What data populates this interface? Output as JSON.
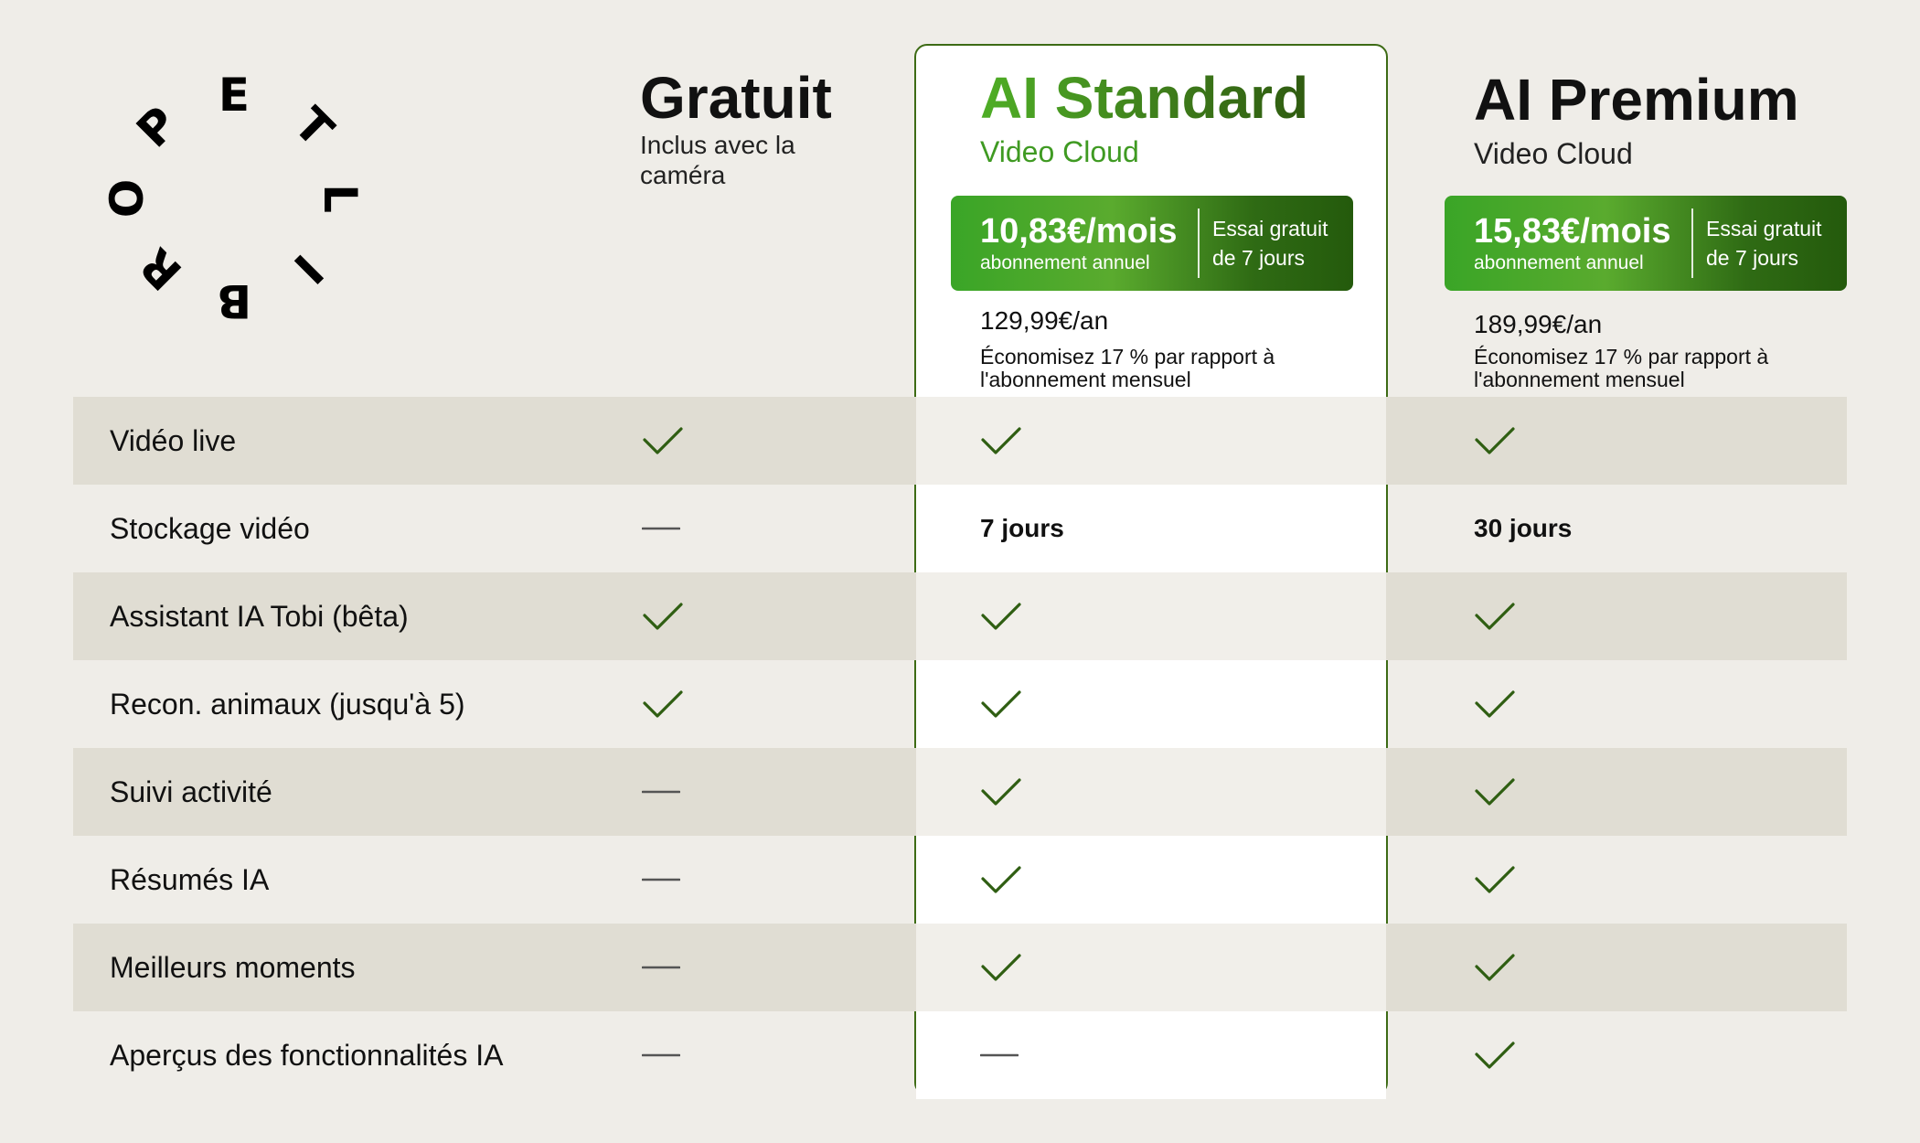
{
  "brand": {
    "letters": [
      "E",
      "T",
      "L",
      "I",
      "B",
      "R",
      "O",
      "P"
    ]
  },
  "plans": [
    {
      "id": "free",
      "title": "Gratuit",
      "subtitle": "Inclus avec la caméra"
    },
    {
      "id": "standard",
      "title": "AI Standard",
      "subtitle": "Video Cloud",
      "price_monthly": "10,83€/mois",
      "price_note": "abonnement annuel",
      "trial": "Essai gratuit de 7 jours",
      "price_annual": "129,99€/an",
      "savings": "Économisez 17 % par rapport à l'abonnement mensuel"
    },
    {
      "id": "premium",
      "title": "AI Premium",
      "subtitle": "Video Cloud",
      "price_monthly": "15,83€/mois",
      "price_note": "abonnement annuel",
      "trial": "Essai gratuit de 7 jours",
      "price_annual": "189,99€/an",
      "savings": "Économisez 17 % par rapport à l'abonnement mensuel"
    }
  ],
  "features": [
    {
      "label": "Vidéo live",
      "free": "check",
      "standard": "check",
      "premium": "check"
    },
    {
      "label": "Stockage vidéo",
      "free": "dash",
      "standard": "7 jours",
      "premium": "30 jours"
    },
    {
      "label": "Assistant IA Tobi (bêta)",
      "free": "check",
      "standard": "check",
      "premium": "check"
    },
    {
      "label": "Recon. animaux (jusqu'à 5)",
      "free": "check",
      "standard": "check",
      "premium": "check"
    },
    {
      "label": "Suivi activité",
      "free": "dash",
      "standard": "check",
      "premium": "check"
    },
    {
      "label": "Résumés IA",
      "free": "dash",
      "standard": "check",
      "premium": "check"
    },
    {
      "label": "Meilleurs moments",
      "free": "dash",
      "standard": "check",
      "premium": "check"
    },
    {
      "label": "Aperçus des fonctionnalités IA",
      "free": "dash",
      "standard": "dash",
      "premium": "check"
    }
  ],
  "colors": {
    "background": "#efede8",
    "row_stripe": "#e0ddd3",
    "accent_green": "#3d6b15",
    "check_green": "#2f5e12",
    "dash_gray": "#555555"
  }
}
